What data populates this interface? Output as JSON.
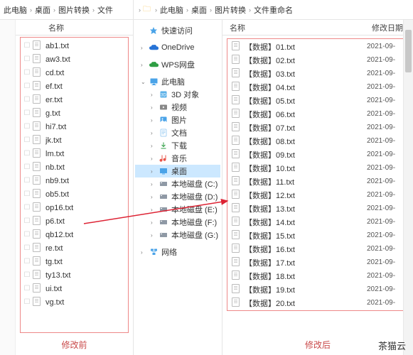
{
  "left": {
    "breadcrumb": [
      "此电脑",
      "桌面",
      "图片转换",
      "文件"
    ],
    "header_name": "名称",
    "files": [
      "ab1.txt",
      "aw3.txt",
      "cd.txt",
      "ef.txt",
      "er.txt",
      "g.txt",
      "hi7.txt",
      "jk.txt",
      "lm.txt",
      "nb.txt",
      "nb9.txt",
      "ob5.txt",
      "op16.txt",
      "p6.txt",
      "qb12.txt",
      "re.txt",
      "tg.txt",
      "ty13.txt",
      "ui.txt",
      "vg.txt"
    ],
    "caption": "修改前"
  },
  "right": {
    "breadcrumb": [
      "此电脑",
      "桌面",
      "图片转换",
      "文件重命名"
    ],
    "header_name": "名称",
    "header_date": "修改日期",
    "nav": {
      "quick": "快速访问",
      "onedrive": "OneDrive",
      "wps": "WPS网盘",
      "thispc": "此电脑",
      "items": [
        "3D 对象",
        "视频",
        "图片",
        "文档",
        "下载",
        "音乐",
        "桌面",
        "本地磁盘 (C:)",
        "本地磁盘 (D:)",
        "本地磁盘 (E:)",
        "本地磁盘 (F:)",
        "本地磁盘 (G:)"
      ],
      "network": "网络"
    },
    "files": [
      "【数据】01.txt",
      "【数据】02.txt",
      "【数据】03.txt",
      "【数据】04.txt",
      "【数据】05.txt",
      "【数据】06.txt",
      "【数据】07.txt",
      "【数据】08.txt",
      "【数据】09.txt",
      "【数据】10.txt",
      "【数据】11.txt",
      "【数据】12.txt",
      "【数据】13.txt",
      "【数据】14.txt",
      "【数据】15.txt",
      "【数据】16.txt",
      "【数据】17.txt",
      "【数据】18.txt",
      "【数据】19.txt",
      "【数据】20.txt"
    ],
    "date": "2021-09-",
    "caption": "修改后"
  },
  "icons": {
    "star": "#f0b44c",
    "cloud": "#2773d6",
    "wps": "#2f9e44",
    "pc": "#4aa3e8",
    "folder": "#f8c048",
    "disk": "#8f99a5",
    "net": "#4aa3e8"
  },
  "watermark": "茶猫云"
}
